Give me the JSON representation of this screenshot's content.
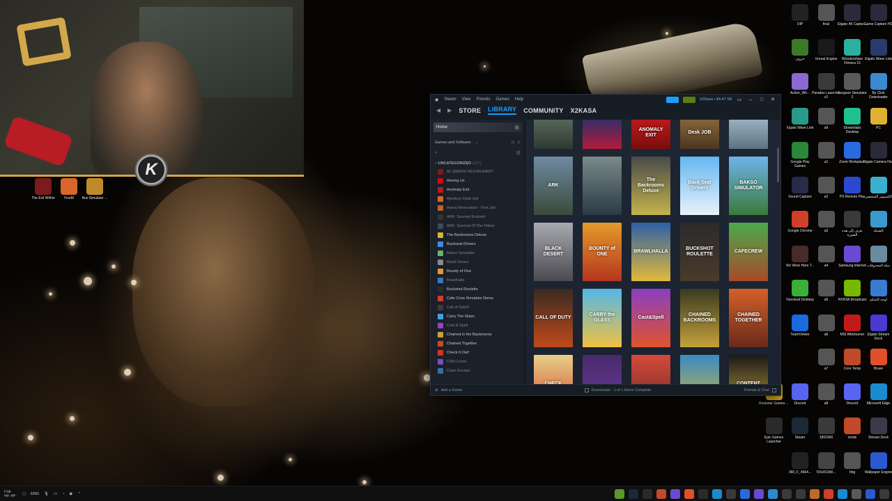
{
  "webcam": {
    "logo_letter": "K"
  },
  "left_icons": [
    {
      "label": "The Evil Within",
      "icon": "evil-within-icon",
      "color": "#7b1b1b"
    },
    {
      "label": "FiveM",
      "icon": "fivem-icon",
      "color": "#d9652b"
    },
    {
      "label": "Bus Simulator ...",
      "icon": "bus-simulator-icon",
      "color": "#c08a2a"
    }
  ],
  "steam": {
    "menu": [
      "Steam",
      "View",
      "Friends",
      "Games",
      "Help"
    ],
    "account": "X2Kasa • $4.47 S8",
    "nav": {
      "store": "STORE",
      "library": "LIBRARY",
      "community": "COMMUNITY",
      "username": "X2KASA"
    },
    "sidebar": {
      "home": "Home",
      "filter": "Games and Software",
      "category": "UNCATEGORIZED",
      "category_count": "(137)",
      "games": [
        {
          "name": "AL QMRAH RESTAURANT",
          "dim": true,
          "color": "#7b1b1b"
        },
        {
          "name": "Among Us",
          "dim": false,
          "color": "#c51111"
        },
        {
          "name": "Anomaly Exit",
          "dim": false,
          "color": "#b71c1c"
        },
        {
          "name": "Aperture Desk Job",
          "dim": true,
          "color": "#d46a2a"
        },
        {
          "name": "Arena Renovation - First Job",
          "dim": true,
          "color": "#c4612a"
        },
        {
          "name": "ARK: Survival Evolved",
          "dim": true,
          "color": "#333333"
        },
        {
          "name": "ARK: Survival Of The Fittest",
          "dim": true,
          "color": "#3d4a5a"
        },
        {
          "name": "The Backrooms Deluxe",
          "dim": false,
          "color": "#d6b737"
        },
        {
          "name": "Backseat Drivers",
          "dim": false,
          "color": "#3c8de0"
        },
        {
          "name": "Bakso Simulator",
          "dim": true,
          "color": "#6bb36a"
        },
        {
          "name": "Black Desert",
          "dim": true,
          "color": "#8a8a8a"
        },
        {
          "name": "Bounty of One",
          "dim": false,
          "color": "#e3972b"
        },
        {
          "name": "Brawlhalla",
          "dim": true,
          "color": "#3c76b5"
        },
        {
          "name": "Buckshot Roulette",
          "dim": false,
          "color": "#2a2a2a"
        },
        {
          "name": "Cafe Crew Simulator Demo",
          "dim": false,
          "color": "#d83a2d"
        },
        {
          "name": "Call of Duty®",
          "dim": true,
          "color": "#3a3a3a"
        },
        {
          "name": "Carry The Glass",
          "dim": false,
          "color": "#45a3dc"
        },
        {
          "name": "Cast & Spell",
          "dim": true,
          "color": "#9b3fc4"
        },
        {
          "name": "Chained in the Backrooms",
          "dim": false,
          "color": "#c7a23a"
        },
        {
          "name": "Chained Together",
          "dim": false,
          "color": "#c94a1e"
        },
        {
          "name": "Check It Out!",
          "dim": false,
          "color": "#d3332a"
        },
        {
          "name": "Chill Corner",
          "dim": true,
          "color": "#7c4ec7"
        },
        {
          "name": "Class Escape",
          "dim": true,
          "color": "#3a6e9e"
        }
      ]
    },
    "grid_rows": [
      [
        {
          "title": "",
          "bg": "linear-gradient(180deg,#5b6a5a,#2d3a33)"
        },
        {
          "title": "",
          "bg": "linear-gradient(180deg,#2a2f6b,#b31b3b)"
        },
        {
          "title": "ANOMALY EXIT",
          "bg": "linear-gradient(180deg,#c21b1b,#7a0d0d)"
        },
        {
          "title": "Desk JOB",
          "bg": "linear-gradient(180deg,#8a6a3a,#4c3620)"
        },
        {
          "title": "",
          "bg": "linear-gradient(180deg,#a0b6c4,#5d7282)"
        }
      ],
      [
        {
          "title": "ARK",
          "bg": "linear-gradient(180deg,#6f8aa2,#3a4a3a)"
        },
        {
          "title": "",
          "bg": "linear-gradient(180deg,#7a8a8a,#2b3a44)"
        },
        {
          "title": "The Backrooms Deluxe",
          "bg": "linear-gradient(180deg,#4a4a4a,#c4b34a)"
        },
        {
          "title": "Back Seat Drivers",
          "bg": "linear-gradient(180deg,#64b7f0,#e9f2fb)"
        },
        {
          "title": "BAKSO SIMULATOR",
          "bg": "linear-gradient(180deg,#6db4ea,#3a7a3a)"
        }
      ],
      [
        {
          "title": "BLACK DESERT",
          "bg": "linear-gradient(180deg,#a8aab0,#4a4a50)"
        },
        {
          "title": "BOUNTY of ONE",
          "bg": "linear-gradient(180deg,#e59a2b,#b5361e)"
        },
        {
          "title": "BRAWLHALLA",
          "bg": "linear-gradient(180deg,#2c5fa6,#e3b93a)"
        },
        {
          "title": "BUCKSHOT ROULETTE",
          "bg": "linear-gradient(180deg,#2b2b2b,#4a3a2a)"
        },
        {
          "title": "CAFECREW",
          "bg": "linear-gradient(180deg,#4aaa4a,#a84a2a)"
        }
      ],
      [
        {
          "title": "CALL OF DUTY",
          "bg": "linear-gradient(180deg,#3a2a22,#c04a1a)"
        },
        {
          "title": "CARRY the GLASS",
          "bg": "linear-gradient(180deg,#53b8e8,#f0c040)"
        },
        {
          "title": "Cast&Spell",
          "bg": "linear-gradient(180deg,#8a3ec4,#e0542a)"
        },
        {
          "title": "CHAINED BACKROOMS",
          "bg": "linear-gradient(180deg,#3a3a22,#c4a13a)"
        },
        {
          "title": "CHAINED TOGETHER",
          "bg": "linear-gradient(180deg,#d4602a,#6a2a1a)"
        }
      ],
      [
        {
          "title": "CHECK",
          "bg": "linear-gradient(180deg,#e6d08a,#d64a2a)"
        },
        {
          "title": "",
          "bg": "linear-gradient(180deg,#4a2a6a,#6a3aa0)"
        },
        {
          "title": "",
          "bg": "linear-gradient(180deg,#d64a3a,#6a2a2a)"
        },
        {
          "title": "",
          "bg": "linear-gradient(180deg,#3a8ac4,#d6b83a)"
        },
        {
          "title": "CONTENT",
          "bg": "linear-gradient(180deg,#1a1a1a,#c4a23a)"
        }
      ]
    ],
    "status": {
      "add_game": "Add a Game",
      "downloads": "Downloads - 1 of 1 Items Complete",
      "friends": "Friends & Chat"
    }
  },
  "right_icons": [
    {
      "label": "OIP",
      "icon": "oip-icon",
      "color": "#222222",
      "col": 0,
      "row": 0
    },
    {
      "label": "final",
      "icon": "final-icon",
      "color": "#555555",
      "col": 1,
      "row": 0
    },
    {
      "label": "Elgato 4K Captur...",
      "icon": "elgato-4k-icon",
      "color": "#2a2a3a",
      "col": 2,
      "row": 0
    },
    {
      "label": "Game Capture HD",
      "icon": "game-capture-icon",
      "color": "#2a2a3a",
      "col": 3,
      "row": 0
    },
    {
      "label": "حروف",
      "icon": "letters-icon",
      "color": "#3a7a2a",
      "col": 0,
      "row": 1
    },
    {
      "label": "Unreal Engine",
      "icon": "unreal-icon",
      "color": "#1a1a1a",
      "col": 1,
      "row": 1
    },
    {
      "label": "Wondershare Filmora 15",
      "icon": "filmora-icon",
      "color": "#2ab0a0",
      "col": 2,
      "row": 1
    },
    {
      "label": "Elgato Wave Link",
      "icon": "wave-link-icon",
      "color": "#2a3a6a",
      "col": 3,
      "row": 1
    },
    {
      "label": "Action_Wh...",
      "icon": "action-icon",
      "color": "#8a6ad0",
      "col": 0,
      "row": 2
    },
    {
      "label": "Paradox Launcher v2",
      "icon": "paradox-icon",
      "color": "#3a3a3a",
      "col": 1,
      "row": 2
    },
    {
      "label": "Surgeon Simulator 2",
      "icon": "surgeon-icon",
      "color": "#5a5a5a",
      "col": 2,
      "row": 2
    },
    {
      "label": "By Click Downloader",
      "icon": "byclick-icon",
      "color": "#3a8ad0",
      "col": 3,
      "row": 2
    },
    {
      "label": "Elgato Wave Link",
      "icon": "wave-link-2-icon",
      "color": "#2a9a8a",
      "col": 0,
      "row": 3
    },
    {
      "label": "a9",
      "icon": "a9-icon",
      "color": "#555555",
      "col": 1,
      "row": 3
    },
    {
      "label": "Streamlabs Desktop",
      "icon": "streamlabs-icon",
      "color": "#20c090",
      "col": 2,
      "row": 3
    },
    {
      "label": "PC",
      "icon": "pc-folder-icon",
      "color": "#e0b030",
      "col": 3,
      "row": 3
    },
    {
      "label": "Google Play Games",
      "icon": "play-games-icon",
      "color": "#2a8a3a",
      "col": 0,
      "row": 4
    },
    {
      "label": "a1",
      "icon": "a1-icon",
      "color": "#555555",
      "col": 1,
      "row": 4
    },
    {
      "label": "Zoom Workplace",
      "icon": "zoom-icon",
      "color": "#2a6ae0",
      "col": 2,
      "row": 4
    },
    {
      "label": "Elgato Camera Hub",
      "icon": "camera-hub-icon",
      "color": "#2a2a3a",
      "col": 3,
      "row": 4
    },
    {
      "label": "Sound Capture",
      "icon": "sound-capture-icon",
      "color": "#2a2a4a",
      "col": 0,
      "row": 5
    },
    {
      "label": "a2",
      "icon": "a2-icon",
      "color": "#555555",
      "col": 1,
      "row": 5
    },
    {
      "label": "PS Remote Play",
      "icon": "ps-remote-icon",
      "color": "#2a4ad0",
      "col": 2,
      "row": 5
    },
    {
      "label": "الكمبيوتر الشخصي",
      "icon": "computer-icon",
      "color": "#3ab0d0",
      "col": 3,
      "row": 5
    },
    {
      "label": "Google Chrome",
      "icon": "chrome-icon",
      "color": "#d0402a",
      "col": 0,
      "row": 6
    },
    {
      "label": "a3",
      "icon": "a3-icon",
      "color": "#555555",
      "col": 1,
      "row": 6
    },
    {
      "label": "تعرف إلى هذه الصورة",
      "icon": "learn-icon",
      "color": "#3a3a3a",
      "col": 2,
      "row": 6
    },
    {
      "label": "الشبكة",
      "icon": "network-icon",
      "color": "#3a9ad0",
      "col": 3,
      "row": 6
    },
    {
      "label": "We Were Here T...",
      "icon": "we-were-here-icon",
      "color": "#4a2a2a",
      "col": 0,
      "row": 7
    },
    {
      "label": "a4",
      "icon": "a4-icon",
      "color": "#555555",
      "col": 1,
      "row": 7
    },
    {
      "label": "Samsung Internet",
      "icon": "samsung-internet-icon",
      "color": "#6a4ad0",
      "col": 2,
      "row": 7
    },
    {
      "label": "سلة المحذوفات",
      "icon": "recycle-bin-icon",
      "color": "#6a8aa0",
      "col": 3,
      "row": 7
    },
    {
      "label": "Nanoleaf Desktop",
      "icon": "nanoleaf-icon",
      "color": "#3ab03a",
      "col": 0,
      "row": 8
    },
    {
      "label": "a5",
      "icon": "a5-icon",
      "color": "#555555",
      "col": 1,
      "row": 8
    },
    {
      "label": "NVIDIA Broadcast",
      "icon": "nvidia-icon",
      "color": "#76b900",
      "col": 2,
      "row": 8
    },
    {
      "label": "لوحة التحكم",
      "icon": "control-panel-icon",
      "color": "#3a7ad0",
      "col": 3,
      "row": 8
    },
    {
      "label": "TeamViewer",
      "icon": "teamviewer-icon",
      "color": "#1a6ae0",
      "col": 0,
      "row": 9
    },
    {
      "label": "a6",
      "icon": "a6-icon",
      "color": "#555555",
      "col": 1,
      "row": 9
    },
    {
      "label": "MSI Afterburner",
      "icon": "msi-icon",
      "color": "#c01a1a",
      "col": 2,
      "row": 9
    },
    {
      "label": "Elgato Stream Deck",
      "icon": "stream-deck-icon",
      "color": "#4a3ad0",
      "col": 3,
      "row": 9
    },
    {
      "label": "a7",
      "icon": "a7-icon",
      "color": "#555555",
      "col": 1,
      "row": 10
    },
    {
      "label": "Core Temp",
      "icon": "core-temp-icon",
      "color": "#c04a2a",
      "col": 2,
      "row": 10
    },
    {
      "label": "Brave",
      "icon": "brave-icon",
      "color": "#e0502a",
      "col": 3,
      "row": 10
    },
    {
      "label": "Rockstar Games ...",
      "icon": "rockstar-icon",
      "color": "#e0b020",
      "col": -1,
      "row": 11
    },
    {
      "label": "Discord",
      "icon": "discord-icon",
      "color": "#5865f2",
      "col": 0,
      "row": 11
    },
    {
      "label": "a8",
      "icon": "a8-icon",
      "color": "#555555",
      "col": 1,
      "row": 11
    },
    {
      "label": "Discord",
      "icon": "discord-2-icon",
      "color": "#5865f2",
      "col": 2,
      "row": 11
    },
    {
      "label": "Microsoft Edge",
      "icon": "edge-icon",
      "color": "#1a8ad0",
      "col": 3,
      "row": 11
    },
    {
      "label": "Epic Games Launcher",
      "icon": "epic-icon",
      "color": "#2a2a2a",
      "col": -1,
      "row": 12
    },
    {
      "label": "Steam",
      "icon": "steam-icon",
      "color": "#1b2838",
      "col": 0,
      "row": 12
    },
    {
      "label": "1802366",
      "icon": "file-icon",
      "color": "#3a3a3a",
      "col": 1,
      "row": 12
    },
    {
      "label": "mods",
      "icon": "mods-icon",
      "color": "#c04a2a",
      "col": 2,
      "row": 12
    },
    {
      "label": "Stream Deck",
      "icon": "stream-deck-2-icon",
      "color": "#3a3a4a",
      "col": 3,
      "row": 12
    },
    {
      "label": "360_F_4664...",
      "icon": "image-icon",
      "color": "#222222",
      "col": 0,
      "row": 13
    },
    {
      "label": "f15c812b8...",
      "icon": "image-2-icon",
      "color": "#444444",
      "col": 1,
      "row": 13
    },
    {
      "label": "hhg",
      "icon": "hhg-icon",
      "color": "#555555",
      "col": 2,
      "row": 13
    },
    {
      "label": "Wallpaper Engine",
      "icon": "wallpaper-engine-icon",
      "color": "#2a5ad0",
      "col": 3,
      "row": 13
    }
  ],
  "taskbar": {
    "time": "٢:٥٥",
    "date": "٢٧/٠٧/٢٠",
    "language": "ENG",
    "apps": [
      {
        "icon": "nvidia-task-icon",
        "color": "#5a9a2a"
      },
      {
        "icon": "steam-task-icon",
        "color": "#1b2838"
      },
      {
        "icon": "task-icon-3",
        "color": "#2a2a2a"
      },
      {
        "icon": "task-icon-4",
        "color": "#c04a2a"
      },
      {
        "icon": "task-icon-5",
        "color": "#6a4ad0"
      },
      {
        "icon": "brave-task-icon",
        "color": "#e0502a"
      },
      {
        "icon": "task-icon-7",
        "color": "#2a2a2a"
      },
      {
        "icon": "task-icon-8",
        "color": "#1a8ad0"
      },
      {
        "icon": "task-icon-9",
        "color": "#3a3a3a"
      },
      {
        "icon": "task-icon-10",
        "color": "#2a6ae0"
      },
      {
        "icon": "task-icon-11",
        "color": "#6a4ad0"
      },
      {
        "icon": "task-icon-12",
        "color": "#2a8ad0"
      },
      {
        "icon": "task-icon-13",
        "color": "#3a3a3a"
      },
      {
        "icon": "task-icon-14",
        "color": "#3a3a3a"
      },
      {
        "icon": "task-icon-15",
        "color": "#c06a2a"
      },
      {
        "icon": "chrome-task-icon",
        "color": "#d0402a"
      },
      {
        "icon": "edge-task-icon",
        "color": "#1a8ad0"
      },
      {
        "icon": "task-icon-18",
        "color": "#5a5a5a"
      },
      {
        "icon": "task-icon-19",
        "color": "#2a5ad0"
      },
      {
        "icon": "task-icon-20",
        "color": "#3a3a3a"
      },
      {
        "icon": "task-icon-21",
        "color": "#3a3a3a"
      }
    ]
  }
}
